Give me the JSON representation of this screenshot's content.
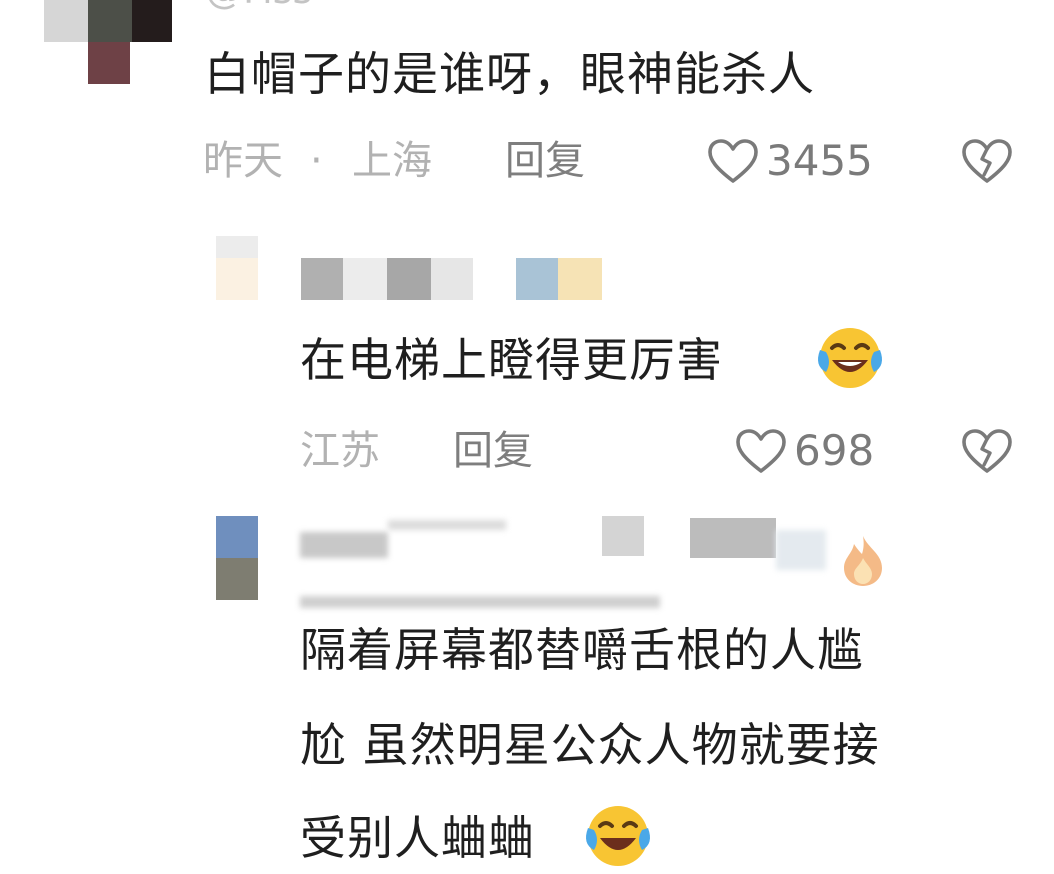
{
  "comments": [
    {
      "username_partial": "@Fiss",
      "text": "白帽子的是谁呀，眼神能杀人",
      "time": "昨天",
      "separator": "·",
      "location": "上海",
      "reply_label": "回复",
      "likes": "3455"
    },
    {
      "text": "在电梯上瞪得更厉害",
      "location": "江苏",
      "reply_label": "回复",
      "likes": "698",
      "emoji": "laughing-tears-emoji"
    },
    {
      "text_line1": "隔着屏幕都替嚼舌根的人尴",
      "text_line2": "尬 虽然明星公众人物就要接",
      "text_line3": "受别人蛐蛐",
      "emoji": "laughing-tears-emoji",
      "badge": "fire-emoji"
    }
  ],
  "icons": {
    "like": "heart-icon",
    "dislike": "broken-heart-icon"
  },
  "colors": {
    "meta_text": "#b2b2b2",
    "reply_text": "#7e7e7e",
    "like_text": "#7a7a7a",
    "body_text": "#1f1f1f"
  }
}
